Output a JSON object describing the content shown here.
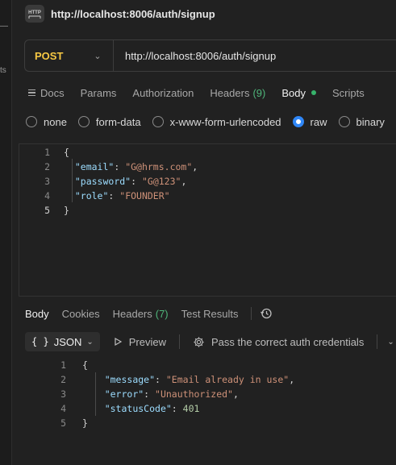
{
  "window": {
    "title": "http://localhost:8006/auth/signup",
    "badge_text": "HTTP"
  },
  "left_strip": {
    "fragment": "ts"
  },
  "request": {
    "method": "POST",
    "url": "http://localhost:8006/auth/signup"
  },
  "request_tabs": {
    "docs": "Docs",
    "params": "Params",
    "authorization": "Authorization",
    "headers": "Headers",
    "headers_count": "(9)",
    "body": "Body",
    "scripts": "Scripts",
    "active": "Body"
  },
  "body_types": {
    "none": "none",
    "form_data": "form-data",
    "urlencoded": "x-www-form-urlencoded",
    "raw": "raw",
    "binary": "binary",
    "selected": "raw"
  },
  "request_body": {
    "line_numbers": [
      "1",
      "2",
      "3",
      "4",
      "5"
    ],
    "open": "{",
    "close": "}",
    "email_key": "\"email\"",
    "email_val": "\"G@hrms.com\"",
    "password_key": "\"password\"",
    "password_val": "\"G@123\"",
    "role_key": "\"role\"",
    "role_val": "\"FOUNDER\""
  },
  "response_tabs": {
    "body": "Body",
    "cookies": "Cookies",
    "headers": "Headers",
    "headers_count": "(7)",
    "test_results": "Test Results",
    "active": "Body"
  },
  "response_toolbar": {
    "format": "JSON",
    "format_braces": "{ }",
    "preview": "Preview",
    "hint": "Pass the correct auth credentials"
  },
  "response_body": {
    "line_numbers": [
      "1",
      "2",
      "3",
      "4",
      "5"
    ],
    "open": "{",
    "close": "}",
    "message_key": "\"message\"",
    "message_val": "\"Email already in use\"",
    "error_key": "\"error\"",
    "error_val": "\"Unauthorized\"",
    "status_key": "\"statusCode\"",
    "status_val": "401"
  },
  "colors": {
    "method_post": "#f7c843",
    "status_dot": "#37b36b",
    "radio_selected": "#2f86f6",
    "json_key": "#9cdcfe",
    "json_string": "#ce9178",
    "json_number": "#b5cea8"
  }
}
